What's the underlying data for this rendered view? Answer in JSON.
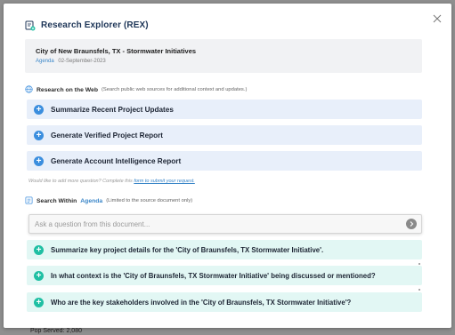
{
  "backdrop": {
    "text": "Pop Served: 2,080"
  },
  "modal": {
    "title": "Research Explorer (REX)",
    "close_icon": "close-icon"
  },
  "document": {
    "title": "City of New Braunsfels, TX - Stormwater Initiatives",
    "type": "Agenda",
    "date": "02-September-2023"
  },
  "web_section": {
    "title": "Research on the Web",
    "hint": "(Search public web sources for additional context and updates.)",
    "icon": "globe-icon",
    "buttons": [
      {
        "label": "Summarize Recent Project Updates"
      },
      {
        "label": "Generate Verified Project Report"
      },
      {
        "label": "Generate Account Intelligence Report"
      }
    ],
    "request_prefix": "Would like to add more question? Complete this",
    "request_link": "form to submit your request."
  },
  "doc_section": {
    "title": "Search Within",
    "link": "Agenda",
    "hint": "(Limited to the source document only)",
    "icon": "document-search-icon",
    "input_placeholder": "Ask a question from this document...",
    "questions": [
      {
        "label": "Summarize key project details for the 'City of Braunsfels, TX Stormwater Initiative'."
      },
      {
        "label": "In what context is the 'City of Braunsfels, TX Stormwater Initiative' being discussed or mentioned?"
      },
      {
        "label": "Who are the key stakeholders involved in the 'City of Braunsfels, TX Stormwater Initiative'?"
      }
    ]
  },
  "colors": {
    "accent_blue": "#3b8ede",
    "accent_teal": "#1fbfa3",
    "web_btn_bg": "#e8effa",
    "question_bg": "#e2f7f4"
  }
}
